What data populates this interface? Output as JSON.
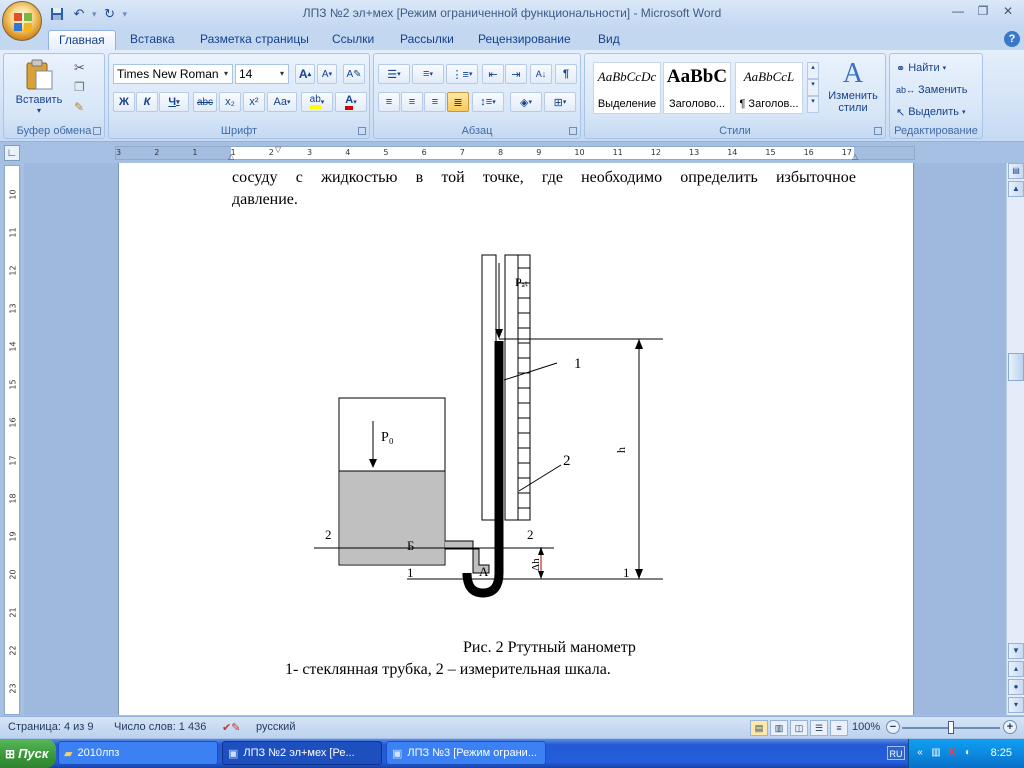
{
  "window": {
    "title": "ЛПЗ №2 эл+мех [Режим ограниченной функциональности] - Microsoft Word"
  },
  "quick_access": {
    "icons": [
      "save-icon",
      "undo-icon",
      "redo-icon",
      "customize-icon"
    ]
  },
  "tabs": [
    "Главная",
    "Вставка",
    "Разметка страницы",
    "Ссылки",
    "Рассылки",
    "Рецензирование",
    "Вид"
  ],
  "ribbon": {
    "clipboard": {
      "label": "Буфер обмена",
      "paste_label": "Вставить"
    },
    "font": {
      "label": "Шрифт",
      "font_name": "Times New Roman",
      "font_size": "14",
      "bold": "Ж",
      "italic": "К",
      "underline": "Ч",
      "strike": "abc",
      "subscript": "x₂",
      "superscript": "x²",
      "change_case": "Aa",
      "grow": "A",
      "shrink": "A",
      "text_color": "#d00000",
      "highlight_color": "#ffff00"
    },
    "paragraph": {
      "label": "Абзац"
    },
    "styles": {
      "label": "Стили",
      "items": [
        {
          "sample": "AaBbCcDc",
          "name": "Выделение"
        },
        {
          "sample": "AaBbC",
          "name": "Заголово..."
        },
        {
          "sample": "AaBbCcL",
          "name": "¶ Заголов..."
        }
      ],
      "change_styles": "Изменить стили"
    },
    "editing": {
      "label": "Редактирование",
      "find": "Найти",
      "replace": "Заменить",
      "select": "Выделить"
    }
  },
  "ruler": {
    "h_ticks": [
      "3",
      "2",
      "1",
      "1",
      "2",
      "3",
      "4",
      "5",
      "6",
      "7",
      "8",
      "9",
      "10",
      "11",
      "12",
      "13",
      "14",
      "15",
      "16",
      "17"
    ],
    "v_ticks": [
      "10",
      "11",
      "12",
      "13",
      "14",
      "15",
      "16",
      "17",
      "18",
      "19",
      "20",
      "21",
      "22",
      "23"
    ]
  },
  "document": {
    "line1": "сосуду  с  жидкостью  в  той  точке,  где  необходимо  определить  избыточное",
    "line2": "давление.",
    "figure": {
      "p_atm": "Pₐₜ",
      "p0": "P₀",
      "h_label": "h",
      "dh_label": "Δh",
      "label_1_top": "1",
      "label_2_right": "2",
      "label_2_left": "2",
      "label_2_mid": "2",
      "label_B": "Б",
      "label_A": "A",
      "label_1_left": "1",
      "label_1_right": "1"
    },
    "caption": "Рис. 2 Ртутный манометр",
    "legend": "1- стеклянная трубка, 2 – измерительная шкала."
  },
  "status": {
    "page": "Страница: 4 из 9",
    "words": "Число слов: 1 436",
    "language": "русский",
    "zoom": "100%",
    "zoom_level": 1.0
  },
  "taskbar": {
    "start": "Пуск",
    "tasks": [
      "2010лпз",
      "ЛПЗ №2 эл+мех [Ре...",
      "ЛПЗ №3 [Режим ограни..."
    ],
    "lang": "RU",
    "time": "8:25"
  }
}
